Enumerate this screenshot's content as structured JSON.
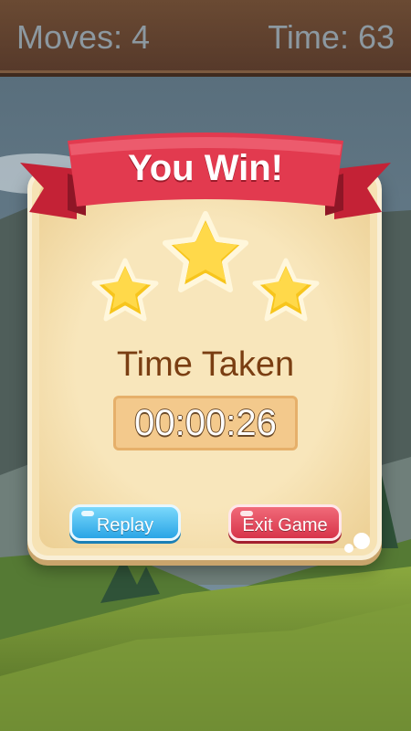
{
  "hud": {
    "moves_text": "Moves: 4",
    "time_text": "Time: 63"
  },
  "dialog": {
    "title": "You Win!",
    "stars_earned": 3,
    "stars_total": 3,
    "time_label": "Time Taken",
    "time_value": "00:00:26"
  },
  "buttons": {
    "replay_label": "Replay",
    "exit_label": "Exit Game"
  },
  "colors": {
    "ribbon": "#e23a4f",
    "panel": "#f6e2b4",
    "star": "#f7c51c",
    "replay_button": "#2aa5e6",
    "exit_button": "#d8344a",
    "time_label": "#7a3e12"
  }
}
